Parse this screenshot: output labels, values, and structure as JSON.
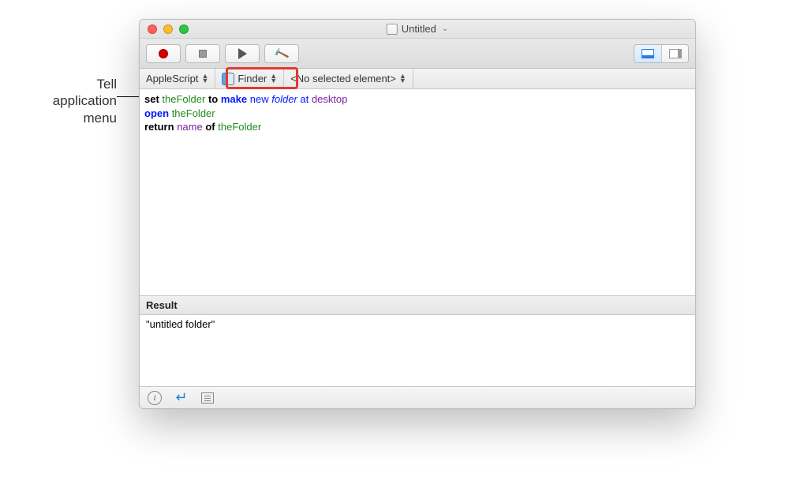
{
  "annotation": {
    "label": "Tell\napplication\nmenu"
  },
  "window": {
    "title": "Untitled",
    "traffic": {
      "close": "close",
      "min": "minimize",
      "max": "zoom"
    }
  },
  "toolbar": {
    "record": "Record",
    "stop": "Stop",
    "run": "Run",
    "compile": "Compile",
    "view_result": "Show result pane",
    "view_side": "Show side pane"
  },
  "navbar": {
    "language": "AppleScript",
    "target_app": "Finder",
    "element": "<No selected element>"
  },
  "script": {
    "line1": {
      "set": "set",
      "var1": "theFolder",
      "to": "to",
      "make": "make",
      "new": "new",
      "folder": "folder",
      "at": "at",
      "desktop": "desktop"
    },
    "line2": {
      "open": "open",
      "var1": "theFolder"
    },
    "line3": {
      "return": "return",
      "name": "name",
      "of": "of",
      "var1": "theFolder"
    }
  },
  "result": {
    "header": "Result",
    "value": "\"untitled folder\""
  },
  "statusbar": {
    "info": "i",
    "return": "↵",
    "log": "log"
  },
  "highlight": {
    "target": "tell-application-menu"
  }
}
